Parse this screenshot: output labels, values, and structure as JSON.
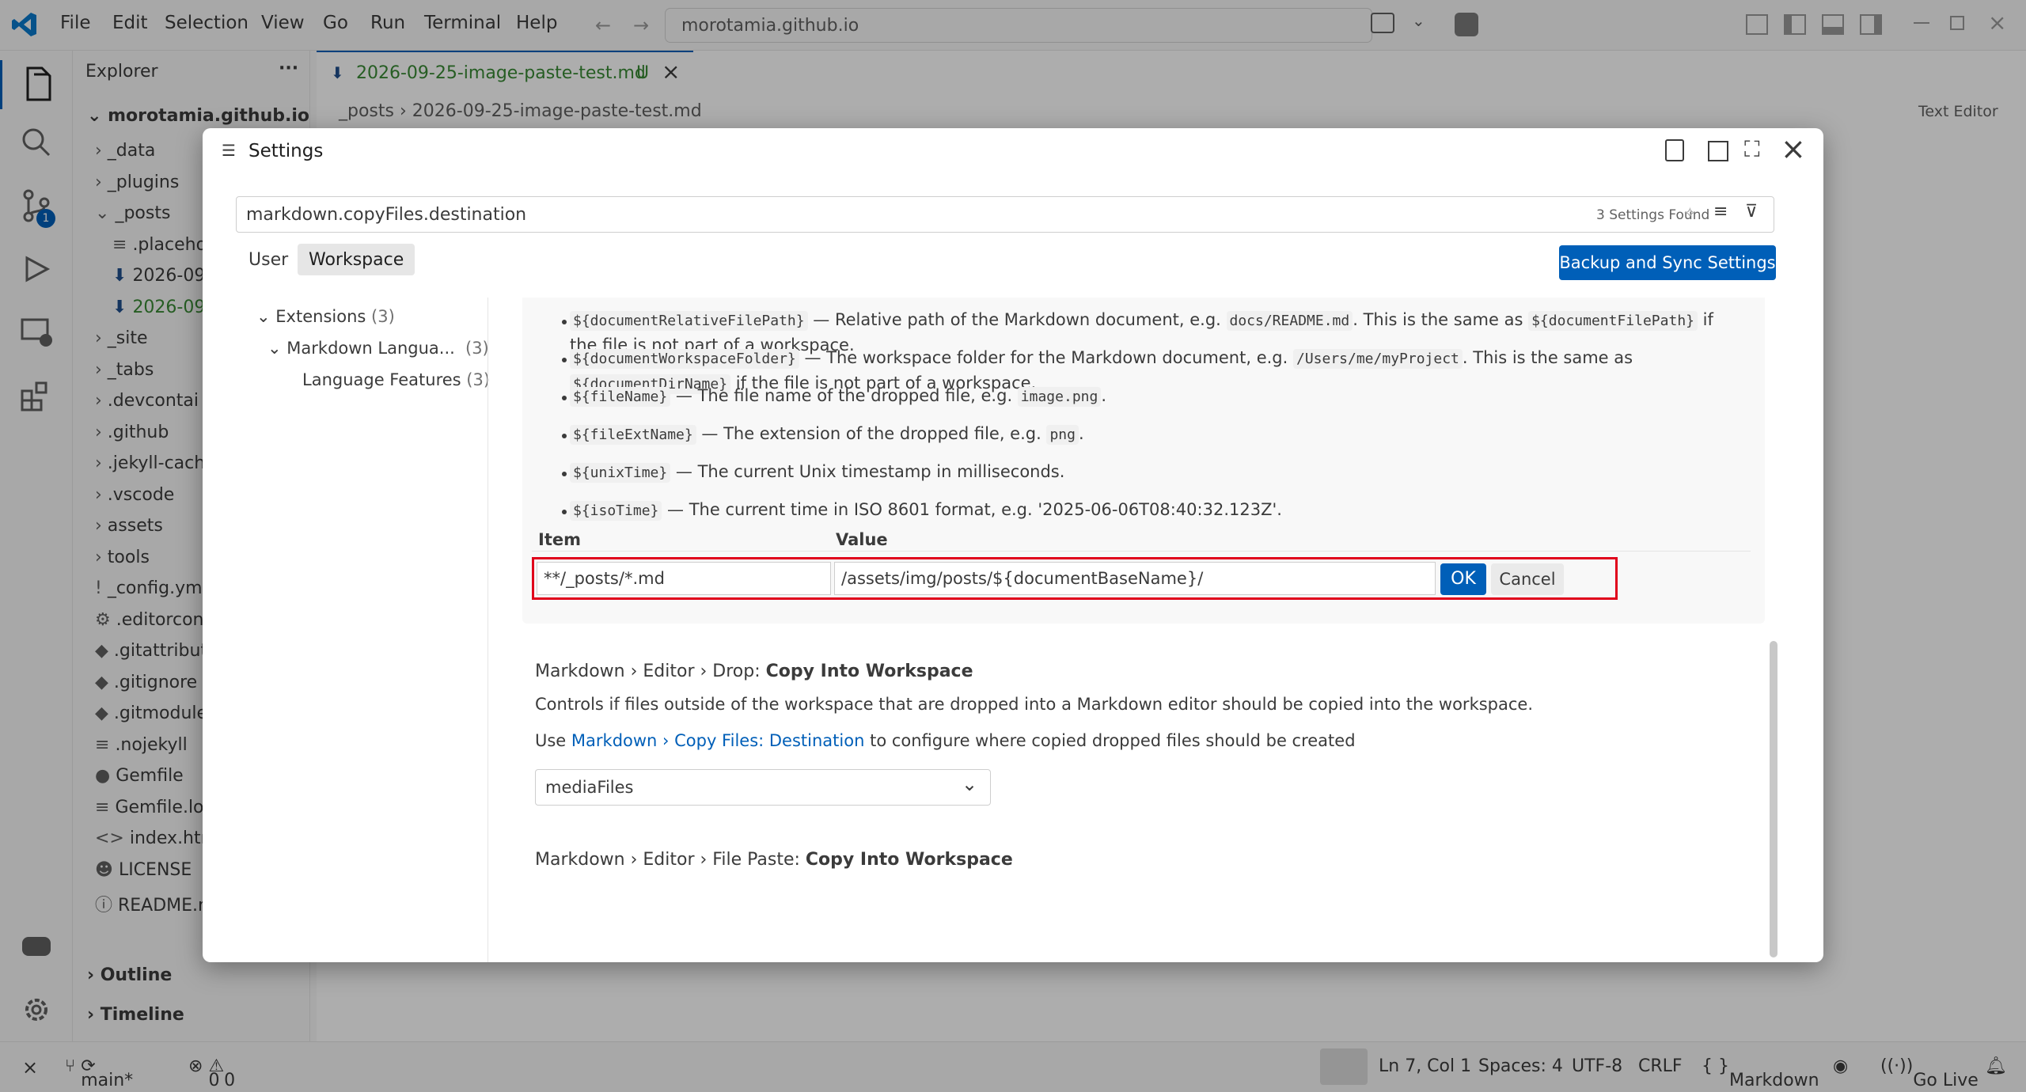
{
  "menu": [
    "File",
    "Edit",
    "Selection",
    "View",
    "Go",
    "Run",
    "Terminal",
    "Help"
  ],
  "address": "morotamia.github.io",
  "sidebar": {
    "title": "Explorer",
    "root": "morotamia.github.io",
    "items": [
      "_data",
      "_plugins",
      "_posts",
      ".placehol",
      "2026-09-",
      "2026-09-",
      "_site",
      "_tabs",
      ".devcontai",
      ".github",
      ".jekyll-cach",
      ".vscode",
      "assets",
      "tools",
      "_config.ym",
      ".editorcon",
      ".gitattribut",
      ".gitignore",
      ".gitmodule",
      ".nojekyll",
      "Gemfile",
      "Gemfile.loc",
      "index.html",
      "LICENSE",
      "README.m"
    ],
    "outline": "Outline",
    "timeline": "Timeline"
  },
  "editor": {
    "tab_label": "2026-09-25-image-paste-test.md",
    "tab_badge": "U",
    "breadcrumb_folder": "_posts",
    "breadcrumb_file": "2026-09-25-image-paste-test.md",
    "text_editor_label": "Text Editor"
  },
  "settings": {
    "title": "Settings",
    "search_value": "markdown.copyFiles.destination",
    "found": "3 Settings Found",
    "tab_user": "User",
    "tab_workspace": "Workspace",
    "backup_button": "Backup and Sync Settings",
    "toc": {
      "extensions": "Extensions",
      "extensions_count": "(3)",
      "markdown": "Markdown Langua...",
      "markdown_count": "(3)",
      "language": "Language Features",
      "language_count": "(3)"
    },
    "bullets": [
      {
        "code": "${documentRelativeFilePath}",
        "t1": " — Relative path of the Markdown document, e.g. ",
        "code2": "docs/README.md",
        "t2": ". This is the same as ",
        "code3": "${documentFilePath}",
        "t3": " if",
        "l2": "the file is not part of a workspace."
      },
      {
        "code": "${documentWorkspaceFolder}",
        "t1": " — The workspace folder for the Markdown document, e.g. ",
        "code2": "/Users/me/myProject",
        "t2": ". This is the same as",
        "code3": "${documentDirName}",
        "t3": " if the file is not part of a workspace."
      },
      {
        "code": "${fileName}",
        "t1": " — The file name of the dropped file, e.g. ",
        "code2": "image.png",
        "t2": "."
      },
      {
        "code": "${fileExtName}",
        "t1": " — The extension of the dropped file, e.g. ",
        "code2": "png",
        "t2": "."
      },
      {
        "code": "${unixTime}",
        "t1": " — The current Unix timestamp in milliseconds."
      },
      {
        "code": "${isoTime}",
        "t1": " — The current time in ISO 8601 format, e.g. '2025-06-06T08:40:32.123Z'."
      }
    ],
    "table": {
      "col_item": "Item",
      "col_value": "Value",
      "item_value": "**/_posts/*.md",
      "value_value": "/assets/img/posts/${documentBaseName}/",
      "ok": "OK",
      "cancel": "Cancel"
    },
    "drop": {
      "crumb": "Markdown › Editor › Drop: ",
      "name": "Copy Into Workspace",
      "desc": "Controls if files outside of the workspace that are dropped into a Markdown editor should be copied into the workspace.",
      "use_pre": "Use ",
      "use_link": "Markdown › Copy Files: Destination",
      "use_post": " to configure where copied dropped files should be created",
      "select": "mediaFiles"
    },
    "paste": {
      "crumb": "Markdown › Editor › File Paste: ",
      "name": "Copy Into Workspace"
    }
  },
  "status": {
    "branch": "main*",
    "errors": "0",
    "warnings": "0",
    "position": "Ln 7, Col 1",
    "spaces": "Spaces: 4",
    "encoding": "UTF-8",
    "eol": "CRLF",
    "language": "Markdown",
    "golive": "Go Live",
    "scm_badge": "1"
  }
}
